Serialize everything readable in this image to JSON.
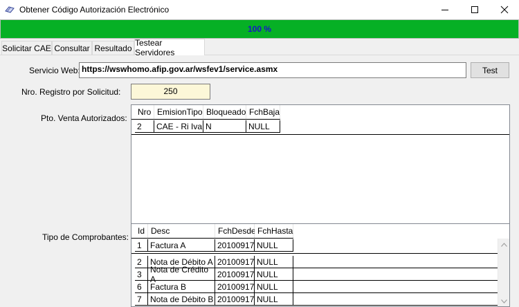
{
  "window": {
    "title": "Obtener Código Autorización Electrónico",
    "minimize_icon": "minimize-icon",
    "maximize_icon": "maximize-icon",
    "close_icon": "close-icon"
  },
  "progress": {
    "text": "100 %",
    "value": 1.0,
    "color": "#06b025",
    "text_color": "#1a14c8"
  },
  "tabs": [
    {
      "label": "Solicitar CAE"
    },
    {
      "label": "Consultar"
    },
    {
      "label": "Resultado"
    },
    {
      "label": "Testear Servidores",
      "active": true
    }
  ],
  "form": {
    "service_label": "Servicio Web:",
    "service_value": "https://wswhomo.afip.gov.ar/wsfev1/service.asmx",
    "test_button": "Test",
    "registro_label": "Nro. Registro por Solicitud:",
    "registro_value": "250",
    "ptoventa_label": "Pto. Venta Autorizados:",
    "comprobantes_label": "Tipo de Comprobantes:"
  },
  "ptoventa_grid": {
    "columns": [
      "Nro",
      "EmisionTipo",
      "Bloqueado",
      "FchBaja"
    ],
    "rows": [
      [
        "2",
        "CAE - Ri Iva",
        "N",
        "NULL"
      ]
    ]
  },
  "comprobantes_grid": {
    "columns": [
      "Id",
      "Desc",
      "FchDesde",
      "FchHasta"
    ],
    "rows": [
      [
        "1",
        "Factura A",
        "20100917",
        "NULL"
      ],
      [
        "2",
        "Nota de Débito A",
        "20100917",
        "NULL"
      ],
      [
        "3",
        "Nota de Crédito A",
        "20100917",
        "NULL"
      ],
      [
        "6",
        "Factura B",
        "20100917",
        "NULL"
      ],
      [
        "7",
        "Nota de Débito B",
        "20100917",
        "NULL"
      ]
    ]
  }
}
